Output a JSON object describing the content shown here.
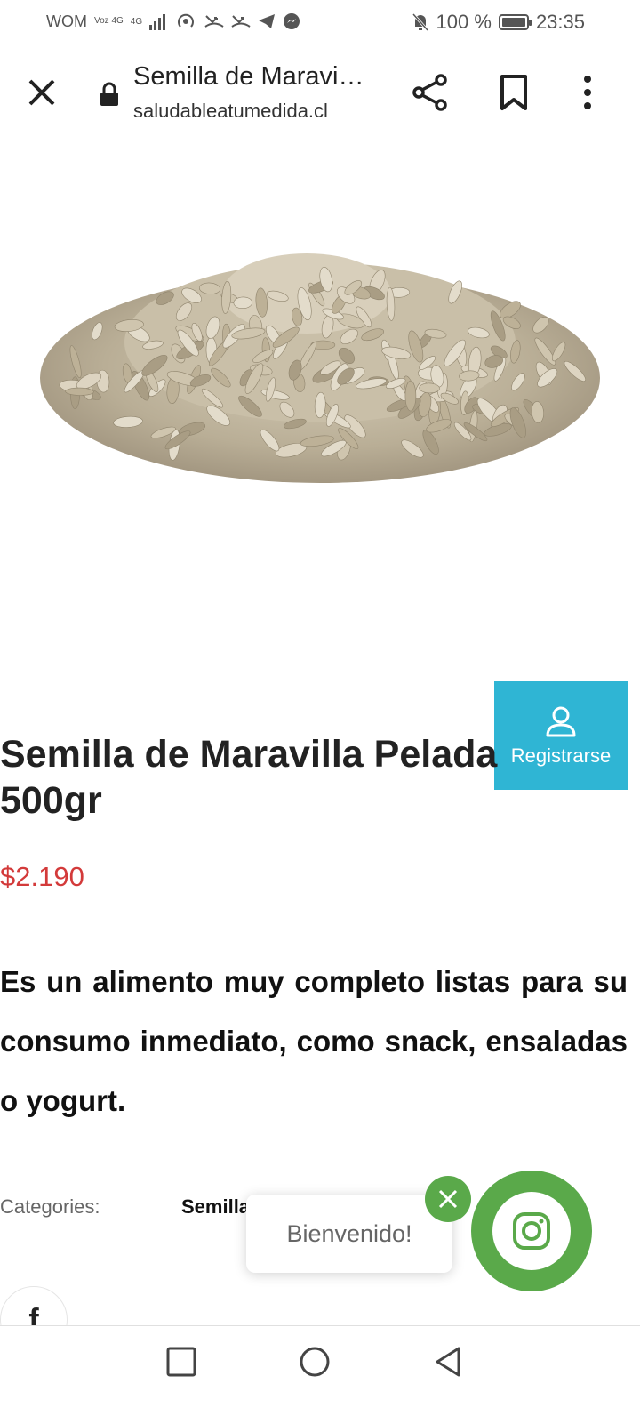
{
  "status_bar": {
    "carrier": "WOM",
    "net_top": "Voz 4G",
    "net_sub": "4G",
    "battery_level": "100 %",
    "battery_fraction": 1.0,
    "time": "23:35"
  },
  "browser": {
    "title": "Semilla de Maravi…",
    "url": "saludableatumedida.cl"
  },
  "product": {
    "title_line1": "Semilla de Maravilla Pelada",
    "title_line2": "500gr",
    "price": "$2.190",
    "description": "Es un alimento muy completo listas para su consumo inmediato, como snack, ensaladas o yogurt.",
    "categories_label": "Categories:",
    "categories_value": "Semillas"
  },
  "register": {
    "label": "Registrarse"
  },
  "chat": {
    "welcome": "Bienvenido!"
  },
  "share": {
    "facebook": "f"
  },
  "colors": {
    "price": "#d33a3a",
    "register_bg": "#2fb5d4",
    "instagram_green": "#5aa94a"
  },
  "icons": [
    "close-icon",
    "lock-icon",
    "share-icon",
    "bookmark-icon",
    "more-vert-icon",
    "user-icon",
    "instagram-icon",
    "facebook-icon",
    "square-nav-icon",
    "circle-nav-icon",
    "back-nav-icon"
  ]
}
